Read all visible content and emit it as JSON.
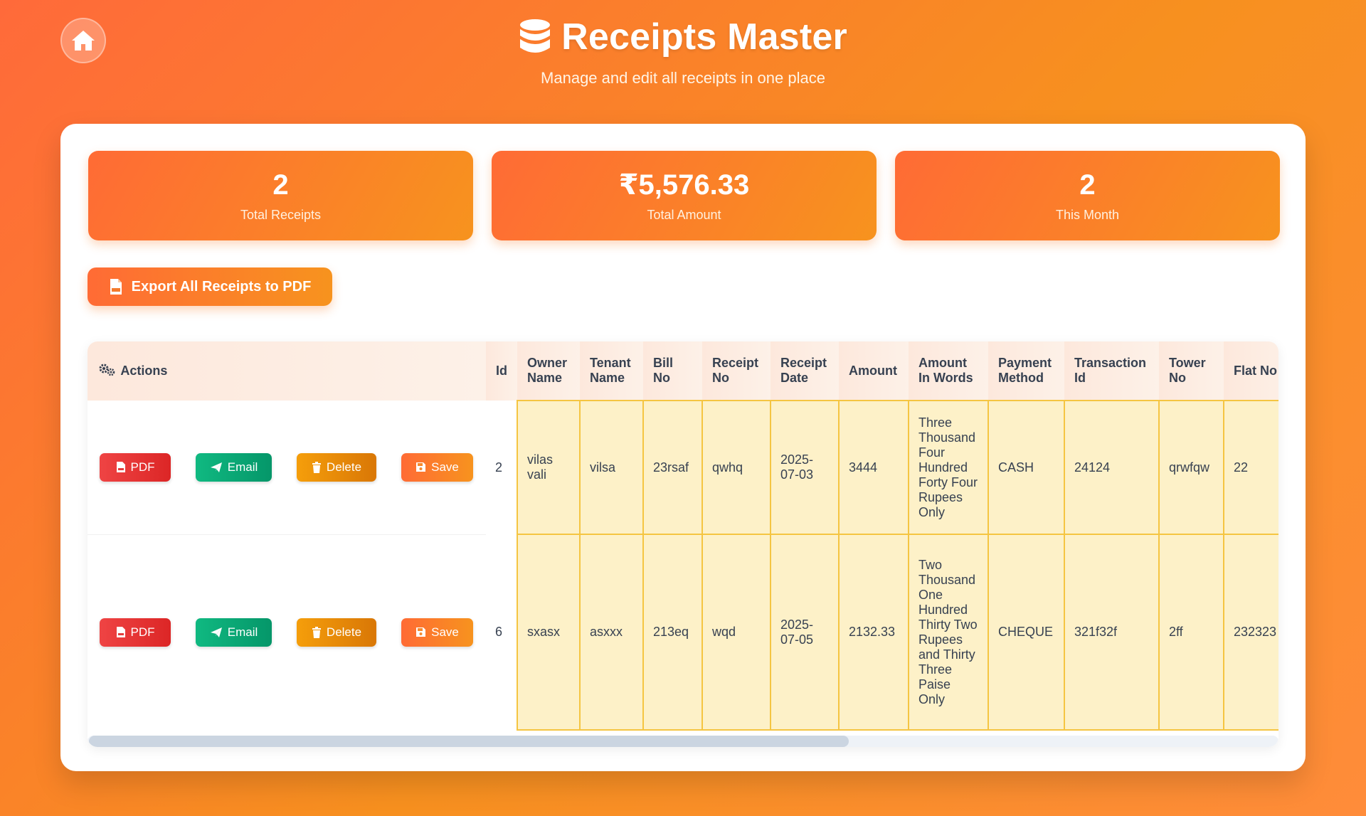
{
  "header": {
    "title": "Receipts Master",
    "subtitle": "Manage and edit all receipts in one place"
  },
  "stats": [
    {
      "value": "2",
      "label": "Total Receipts"
    },
    {
      "value": "₹5,576.33",
      "label": "Total Amount"
    },
    {
      "value": "2",
      "label": "This Month"
    }
  ],
  "export_button": {
    "label": "Export All Receipts to PDF"
  },
  "table": {
    "actions_header": "Actions",
    "headers": [
      {
        "line1": "Id",
        "line2": ""
      },
      {
        "line1": "Owner",
        "line2": "Name"
      },
      {
        "line1": "Tenant",
        "line2": "Name"
      },
      {
        "line1": "Bill",
        "line2": "No"
      },
      {
        "line1": "Receipt",
        "line2": "No"
      },
      {
        "line1": "Receipt",
        "line2": "Date"
      },
      {
        "line1": "Amount",
        "line2": ""
      },
      {
        "line1": "Amount",
        "line2": "In Words"
      },
      {
        "line1": "Payment",
        "line2": "Method"
      },
      {
        "line1": "Transaction",
        "line2": "Id"
      },
      {
        "line1": "Tower",
        "line2": "No"
      },
      {
        "line1": "Flat No",
        "line2": ""
      }
    ],
    "action_labels": {
      "pdf": "PDF",
      "email": "Email",
      "delete": "Delete",
      "save": "Save"
    },
    "rows": [
      {
        "id": "2",
        "owner_name": "vilas vali",
        "tenant_name": "vilsa",
        "bill_no": "23rsaf",
        "receipt_no": "qwhq",
        "receipt_date": "2025-07-03",
        "amount": "3444",
        "amount_in_words": "Three Thousand Four Hundred Forty Four Rupees Only",
        "payment_method": "CASH",
        "transaction_id": "24124",
        "tower_no": "qrwfqw",
        "flat_no": "22"
      },
      {
        "id": "6",
        "owner_name": "sxasx",
        "tenant_name": "asxxx",
        "bill_no": "213eq",
        "receipt_no": "wqd",
        "receipt_date": "2025-07-05",
        "amount": "2132.33",
        "amount_in_words": "Two Thousand One Hundred Thirty Two Rupees and Thirty Three Paise Only",
        "payment_method": "CHEQUE",
        "transaction_id": "321f32f",
        "tower_no": "2ff",
        "flat_no": "232323"
      }
    ]
  },
  "colors": {
    "accent": "#ff6b35",
    "accent_2": "#f7931e",
    "pdf": "#dc2626",
    "email": "#059669",
    "delete": "#d97706",
    "editable_cell": "#fdf1c8"
  },
  "icons": {
    "home": "home-icon",
    "title": "database-icon",
    "export": "file-pdf-icon",
    "actions": "gears-icon",
    "pdf": "file-pdf-icon",
    "email": "paper-plane-icon",
    "delete": "trash-icon",
    "save": "floppy-disk-icon"
  }
}
